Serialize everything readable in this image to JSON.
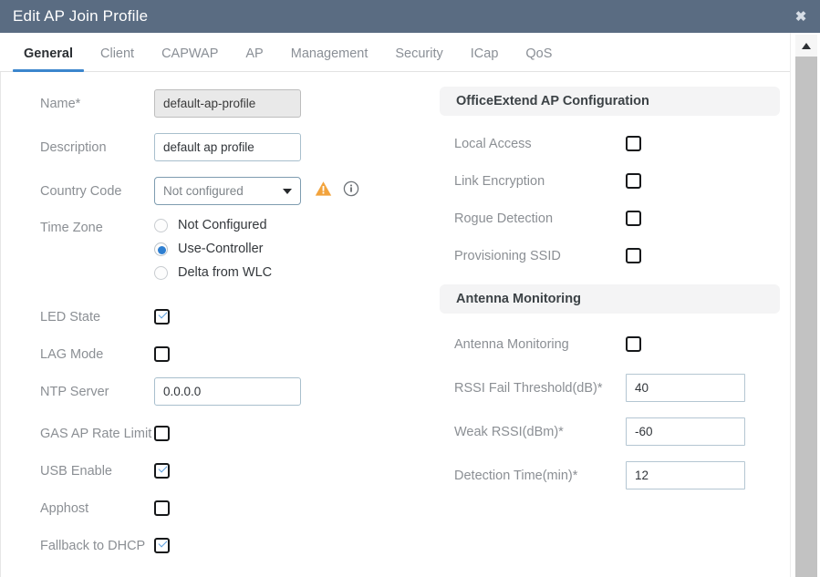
{
  "window": {
    "title": "Edit AP Join Profile",
    "close_label": "✖",
    "header_color": "#5a6c82"
  },
  "tabs": [
    {
      "label": "General",
      "active": true
    },
    {
      "label": "Client",
      "active": false
    },
    {
      "label": "CAPWAP",
      "active": false
    },
    {
      "label": "AP",
      "active": false
    },
    {
      "label": "Management",
      "active": false
    },
    {
      "label": "Security",
      "active": false
    },
    {
      "label": "ICap",
      "active": false
    },
    {
      "label": "QoS",
      "active": false
    }
  ],
  "accent_color": "#3b86cd",
  "left": {
    "name": {
      "label": "Name*",
      "value": "default-ap-profile",
      "disabled": true
    },
    "description": {
      "label": "Description",
      "value": "default ap profile",
      "placeholder": ""
    },
    "country_code": {
      "label": "Country Code",
      "value": "Not configured",
      "warning_icon": "warning-triangle-icon",
      "info_icon": "info-circle-icon",
      "warning_color": "#f2a33c"
    },
    "time_zone": {
      "label": "Time Zone",
      "options": [
        {
          "label": "Not Configured",
          "selected": false
        },
        {
          "label": "Use-Controller",
          "selected": true
        },
        {
          "label": "Delta from WLC",
          "selected": false
        }
      ]
    },
    "led_state": {
      "label": "LED State",
      "checked": true
    },
    "lag_mode": {
      "label": "LAG Mode",
      "checked": false
    },
    "ntp_server": {
      "label": "NTP Server",
      "value": "0.0.0.0"
    },
    "gas_ap_rate_limit": {
      "label": "GAS AP Rate Limit",
      "checked": false
    },
    "usb_enable": {
      "label": "USB Enable",
      "checked": true
    },
    "apphost": {
      "label": "Apphost",
      "checked": false
    },
    "fallback_to_dhcp": {
      "label": "Fallback to DHCP",
      "checked": true
    }
  },
  "right": {
    "officeextend": {
      "section_title": "OfficeExtend AP Configuration",
      "local_access": {
        "label": "Local Access",
        "checked": false
      },
      "link_encryption": {
        "label": "Link Encryption",
        "checked": false
      },
      "rogue_detection": {
        "label": "Rogue Detection",
        "checked": false
      },
      "provisioning_ssid": {
        "label": "Provisioning SSID",
        "checked": false
      }
    },
    "antenna": {
      "section_title": "Antenna Monitoring",
      "antenna_monitoring": {
        "label": "Antenna Monitoring",
        "checked": false
      },
      "rssi_fail_threshold": {
        "label": "RSSI Fail Threshold(dB)*",
        "value": "40"
      },
      "weak_rssi": {
        "label": "Weak RSSI(dBm)*",
        "value": "-60"
      },
      "detection_time": {
        "label": "Detection Time(min)*",
        "value": "12"
      }
    }
  },
  "scrollbar": {
    "up_arrow": "triangle-up-icon"
  }
}
